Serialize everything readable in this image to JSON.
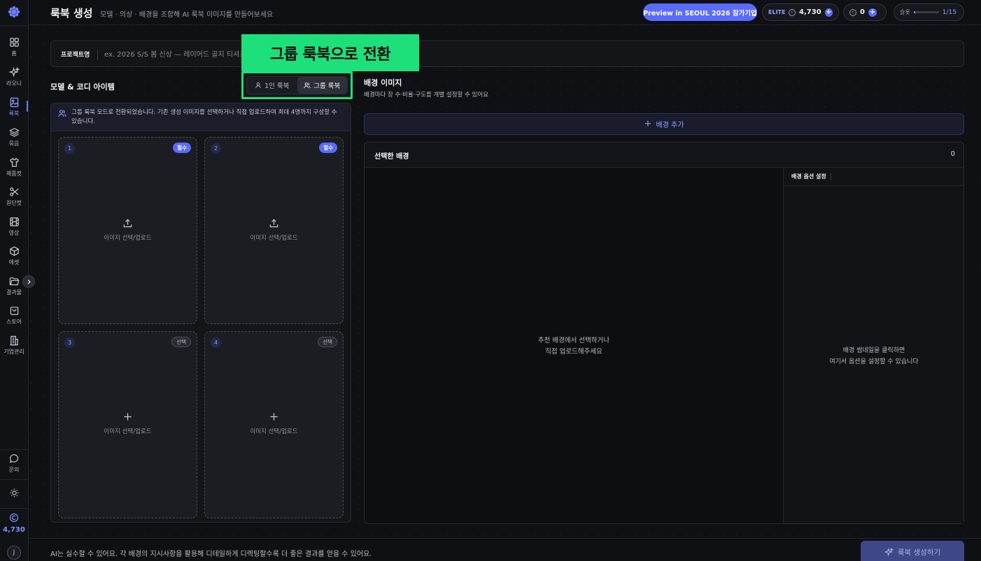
{
  "header": {
    "title": "룩북 생성",
    "subtitle": "모델 · 의상 · 배경을 조합해 AI 룩북 이미지를 만들어보세요",
    "preview_button": "Preview in SEOUL 2026 참가기업",
    "plan_label": "ELITE",
    "plan_credits": "4,730",
    "coins": "0",
    "slot_label": "슬롯",
    "slot_value": "1/15",
    "slot_fill": 0.067
  },
  "sidebar": {
    "items": [
      {
        "label": "홈",
        "icon": "grid-icon"
      },
      {
        "label": "라오니",
        "icon": "sparkle-icon"
      },
      {
        "label": "룩북",
        "icon": "lookbook-icon",
        "active": true
      },
      {
        "label": "묶음",
        "icon": "layers-icon"
      },
      {
        "label": "제품컷",
        "icon": "shirt-icon"
      },
      {
        "label": "원단컷",
        "icon": "scissors-icon"
      },
      {
        "label": "영상",
        "icon": "film-icon"
      },
      {
        "label": "에셋",
        "icon": "cube-icon"
      },
      {
        "label": "결과물",
        "icon": "folder-icon"
      },
      {
        "label": "스토어",
        "icon": "bag-icon"
      },
      {
        "label": "기업관리",
        "icon": "building-icon"
      }
    ],
    "contact_label": "문의",
    "credits": "4,730",
    "avatar_initial": "J"
  },
  "project": {
    "label": "프로젝트명",
    "placeholder": "ex. 2026 S/S 봄 신상 — 레이어드 골지 티셔츠"
  },
  "tooltip": "그룹 룩북으로 전환",
  "models": {
    "title": "모델 & 코디 아이템",
    "toggle_single": "1인 룩북",
    "toggle_group": "그룹 룩북",
    "notice": "그룹 룩북 모드로 전환되었습니다. 기존 생성 이미지를 선택하거나 직접 업로드하여 최대 4명까지 구성할 수 있습니다.",
    "slots": [
      {
        "num": "1",
        "tag": "필수",
        "required": true,
        "label": "이미지 선택/업로드"
      },
      {
        "num": "2",
        "tag": "필수",
        "required": true,
        "label": "이미지 선택/업로드"
      },
      {
        "num": "3",
        "tag": "선택",
        "required": false,
        "label": "이미지 선택/업로드"
      },
      {
        "num": "4",
        "tag": "선택",
        "required": false,
        "label": "이미지 선택/업로드"
      }
    ]
  },
  "background": {
    "title": "배경 이미지",
    "subtitle": "배경마다 장 수·비율·구도를 개별 설정할 수 있어요",
    "add_button": "배경 추가",
    "selected_title": "선택한 배경",
    "selected_count": "0",
    "empty_line1": "추천 배경에서 선택하거나",
    "empty_line2": "직접 업로드해주세요",
    "options_title": "배경 옵션 설정",
    "options_empty_line1": "배경 썸네일을 클릭하면",
    "options_empty_line2": "여기서 옵션을 설정할 수 있습니다"
  },
  "footer": {
    "note": "AI는 실수할 수 있어요. 각 배경의 지시사항을 활용해 디테일하게 디렉팅할수록 더 좋은 결과를 얻을 수 있어요.",
    "generate_button": "룩북 생성하기"
  },
  "colors": {
    "accent": "#5a6bff",
    "highlight": "#1ee07a",
    "background": "#0f1014"
  }
}
